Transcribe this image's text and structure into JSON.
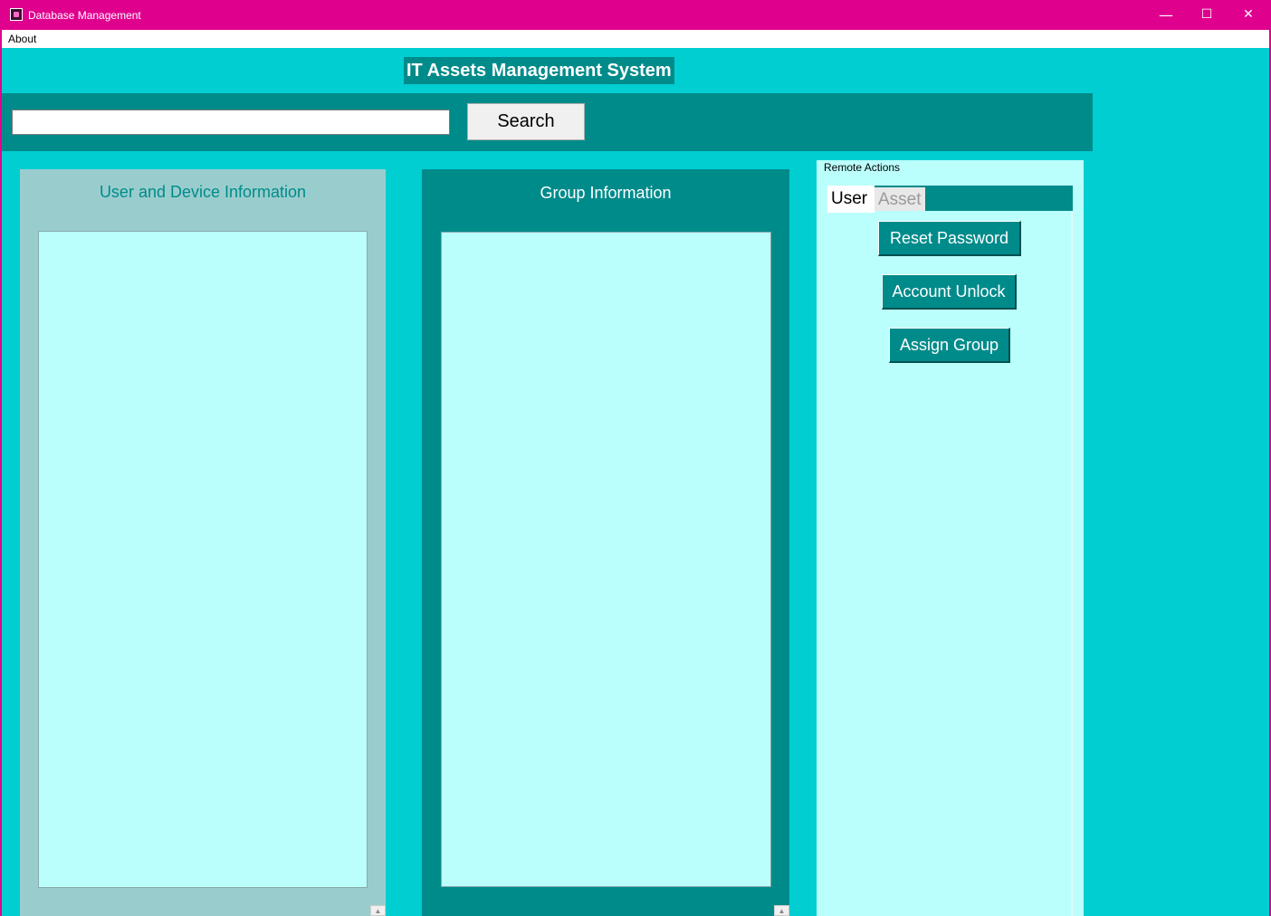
{
  "window": {
    "title": "Database Management",
    "controls": {
      "minimize": "—",
      "maximize": "☐",
      "close": "✕"
    }
  },
  "menubar": {
    "items": [
      "About"
    ]
  },
  "header": {
    "title": "IT Assets Management System"
  },
  "search": {
    "value": "",
    "button_label": "Search"
  },
  "panels": {
    "user_device": {
      "title": "User and Device Information"
    },
    "group": {
      "title": "Group Information"
    }
  },
  "remote_actions": {
    "label": "Remote Actions",
    "tabs": [
      "User",
      "Asset"
    ],
    "selected_tab": "User",
    "buttons": [
      "Reset Password",
      "Account Unlock",
      "Assign Group"
    ]
  },
  "colors": {
    "titlebar": "#e0008e",
    "background": "#00ced1",
    "dark_teal": "#008b8b",
    "light_teal": "#99cdcd",
    "listbox": "#bbfffc"
  },
  "icons": [
    "app-icon",
    "minimize-icon",
    "maximize-icon",
    "close-icon",
    "scroll-up-arrow-icon"
  ]
}
